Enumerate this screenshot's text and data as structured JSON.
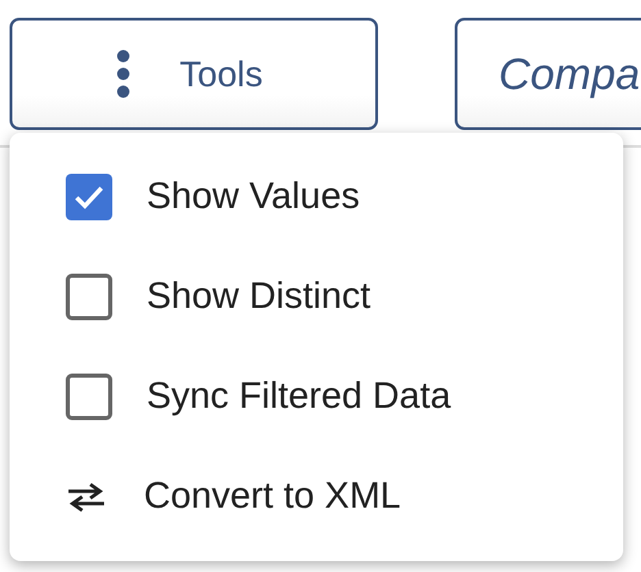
{
  "toolbar": {
    "buttons": [
      {
        "label": "Tools",
        "kind": "menu"
      },
      {
        "label": "Compa",
        "kind": "plain"
      }
    ]
  },
  "menu": {
    "items": [
      {
        "kind": "checkbox",
        "label": "Show Values",
        "checked": true
      },
      {
        "kind": "checkbox",
        "label": "Show Distinct",
        "checked": false
      },
      {
        "kind": "checkbox",
        "label": "Sync Filtered Data",
        "checked": false
      },
      {
        "kind": "action",
        "label": "Convert to XML"
      }
    ]
  }
}
